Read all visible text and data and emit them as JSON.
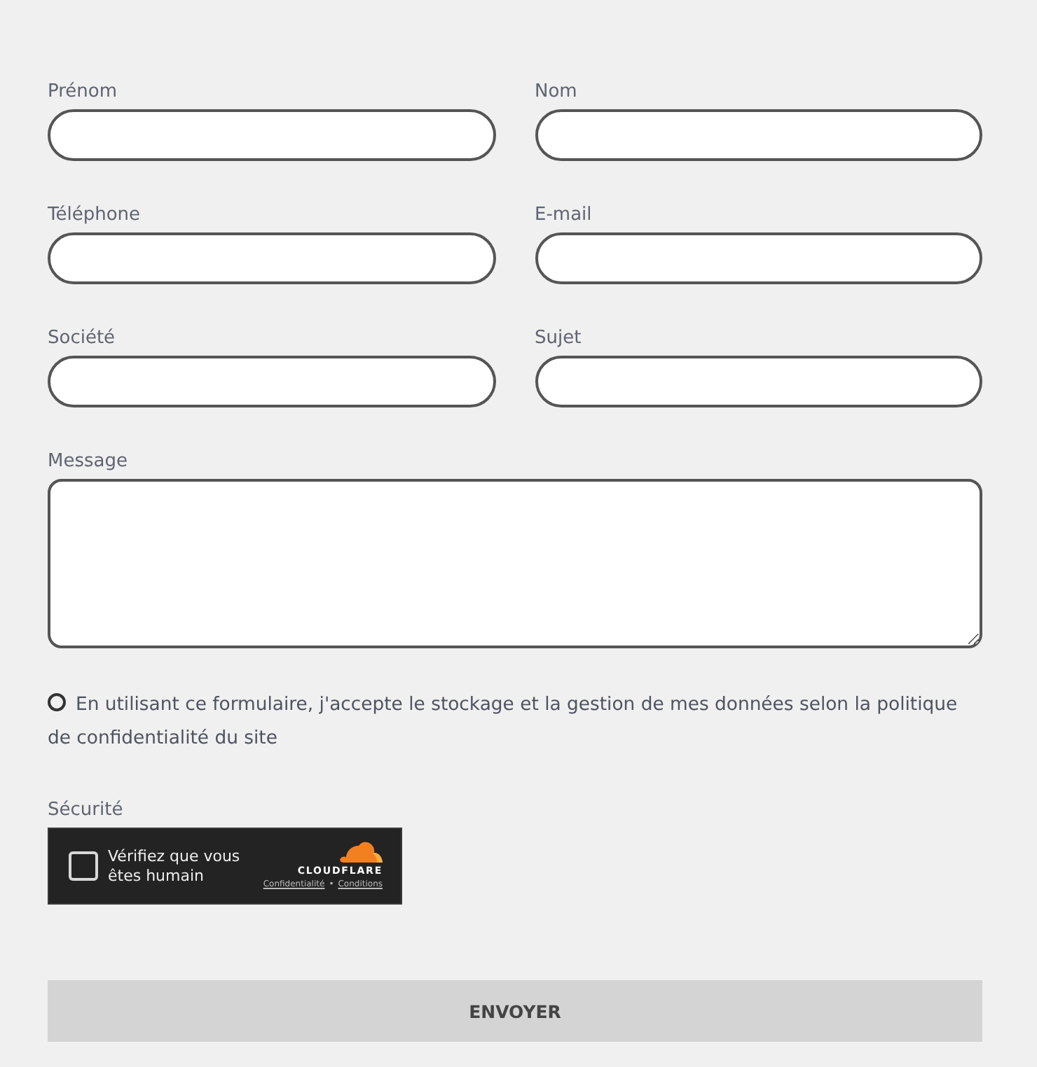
{
  "fields": [
    {
      "label": "Prénom"
    },
    {
      "label": "Nom"
    },
    {
      "label": "Téléphone"
    },
    {
      "label": "E-mail"
    },
    {
      "label": "Société"
    },
    {
      "label": "Sujet"
    }
  ],
  "message": {
    "label": "Message"
  },
  "consent": {
    "checked": false,
    "text": "En utilisant ce formulaire, j'accepte le stockage et la gestion de mes données selon la politique de confidentialité du site"
  },
  "security": {
    "label": "Sécurité",
    "widget": {
      "checked": false,
      "prompt": "Vérifiez que vous êtes humain",
      "brand": "CLOUDFLARE",
      "links": [
        "Confidentialité",
        "Conditions"
      ],
      "separator": "•"
    }
  },
  "submit": {
    "label": "ENVOYER"
  }
}
